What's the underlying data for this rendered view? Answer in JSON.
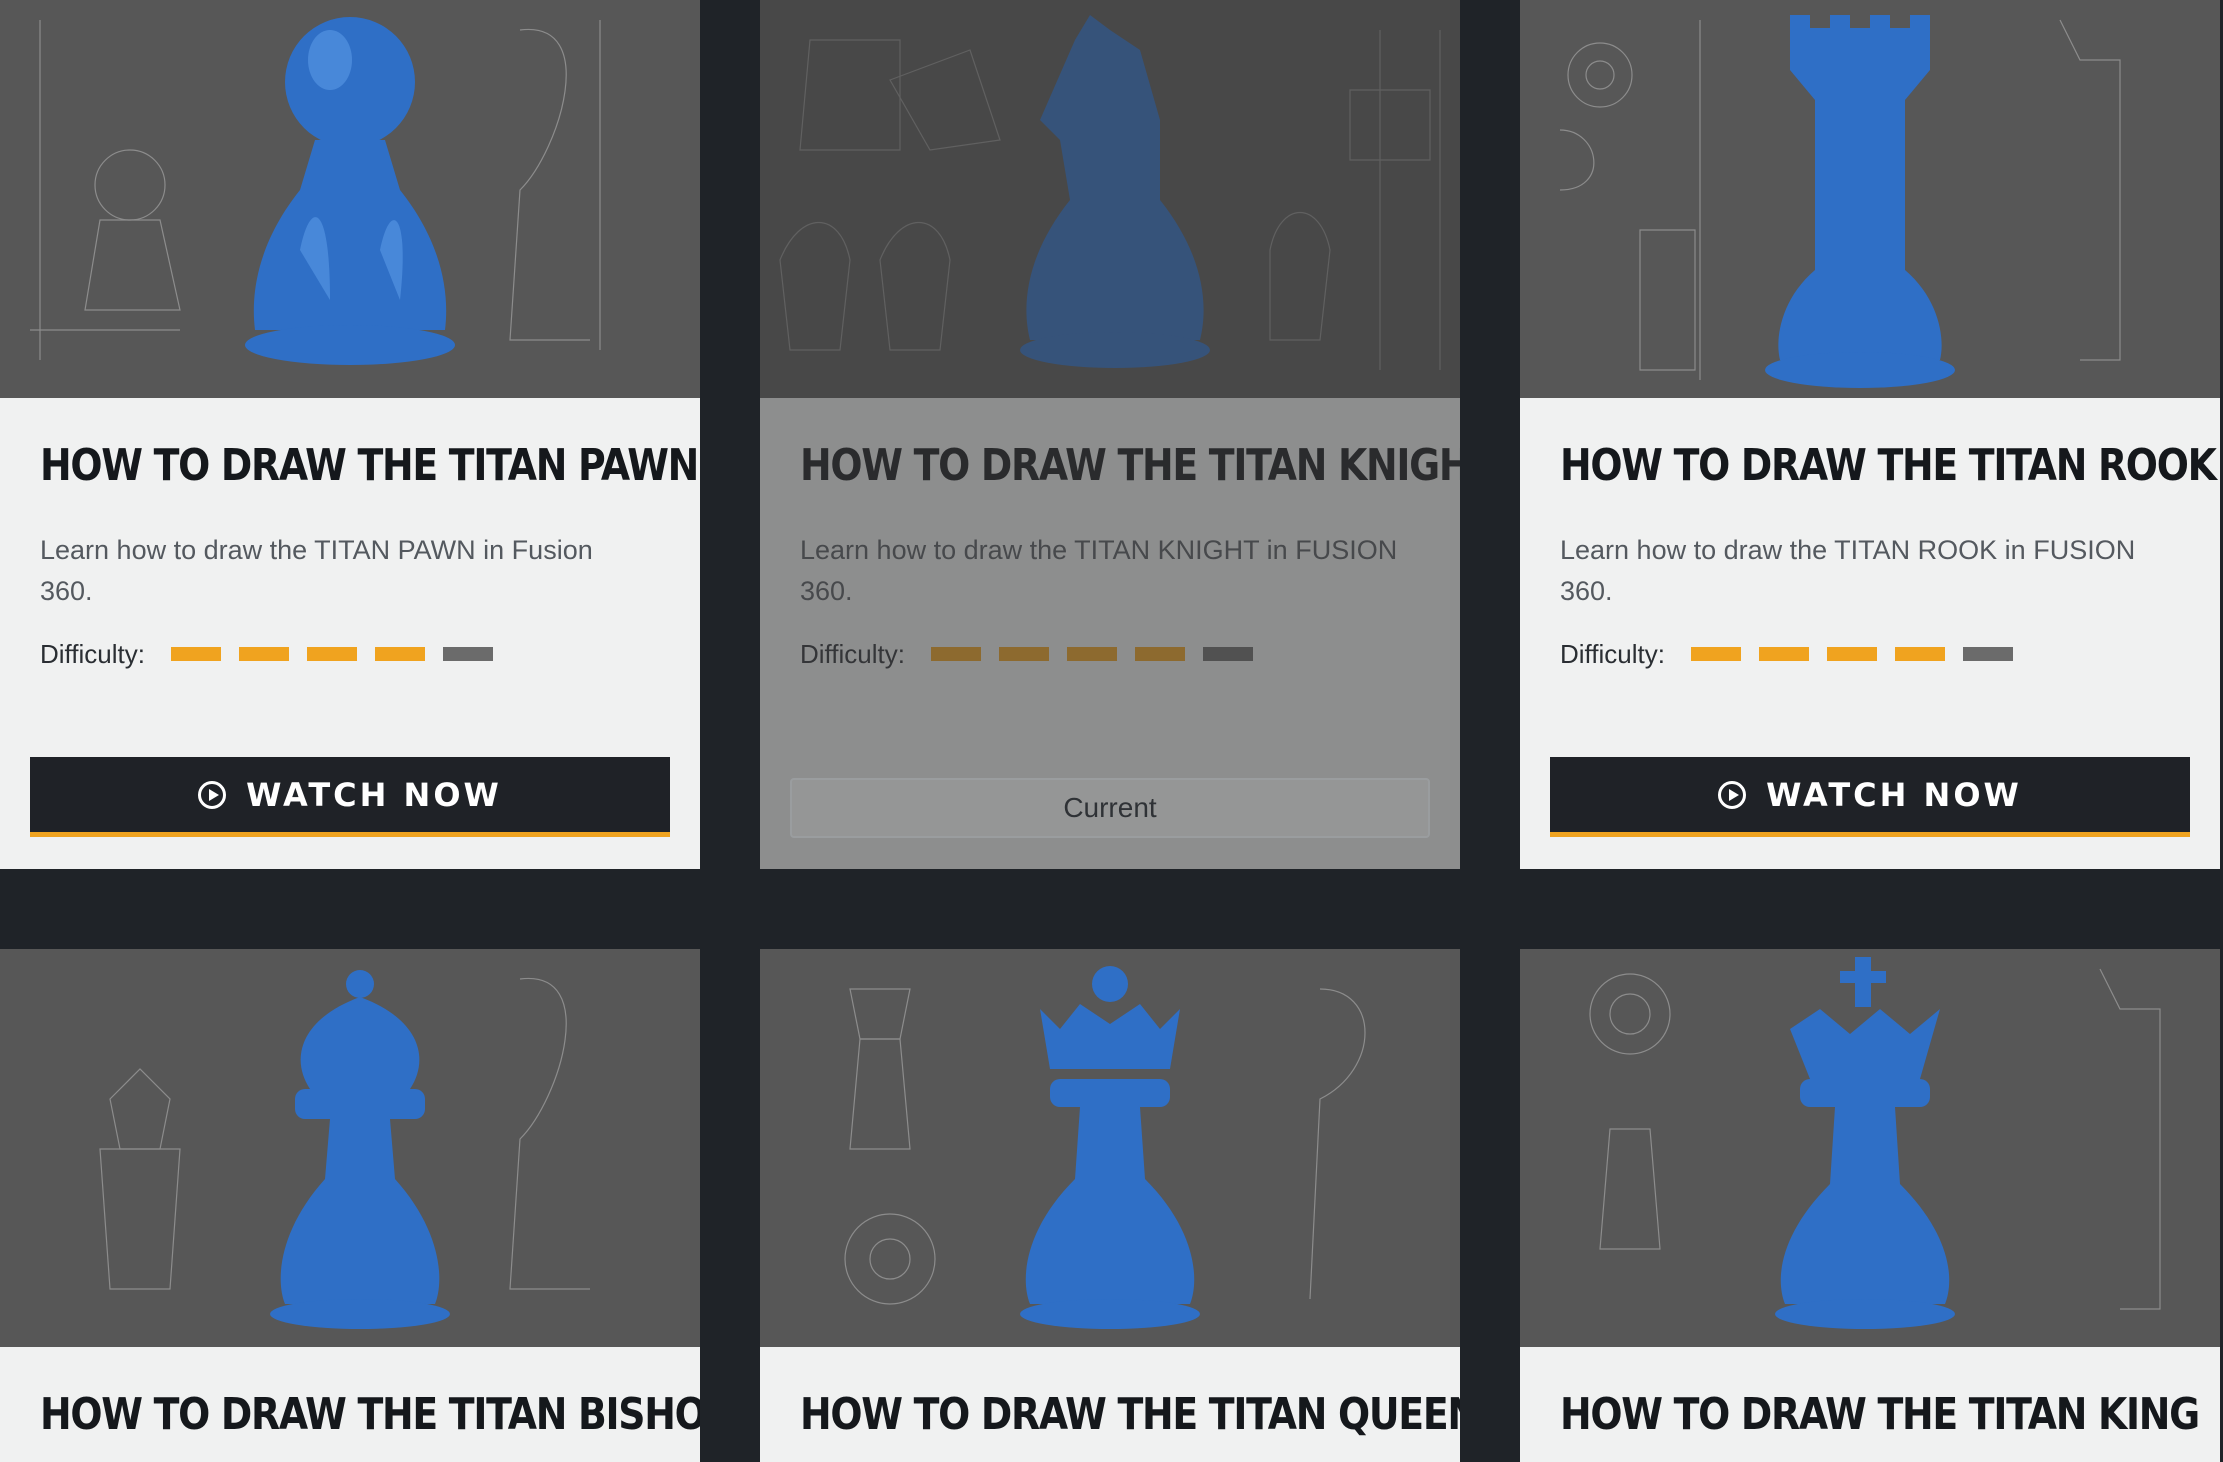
{
  "cards": [
    {
      "title": "HOW TO DRAW THE TITAN PAWN",
      "description": "Learn how to draw the TITAN PAWN in Fusion 360.",
      "difficulty_label": "Difficulty:",
      "difficulty": 4,
      "difficulty_max": 5,
      "action": "WATCH NOW",
      "image": "titan-pawn-blueprint-render"
    },
    {
      "title": "HOW TO DRAW THE TITAN KNIGHT",
      "description": "Learn how to draw the TITAN KNIGHT in FUSION 360.",
      "difficulty_label": "Difficulty:",
      "difficulty": 4,
      "difficulty_max": 5,
      "action": "Current",
      "image": "titan-knight-blueprint-render"
    },
    {
      "title": "HOW TO DRAW THE TITAN ROOK",
      "description": "Learn how to draw the TITAN ROOK in FUSION 360.",
      "difficulty_label": "Difficulty:",
      "difficulty": 4,
      "difficulty_max": 5,
      "action": "WATCH NOW",
      "image": "titan-rook-blueprint-render"
    },
    {
      "title": "HOW TO DRAW THE TITAN BISHOP",
      "image": "titan-bishop-blueprint-render"
    },
    {
      "title": "HOW TO DRAW THE TITAN QUEEN",
      "image": "titan-queen-blueprint-render"
    },
    {
      "title": "HOW TO DRAW THE TITAN KING",
      "image": "titan-king-blueprint-render"
    }
  ],
  "colors": {
    "accent": "#f0a31f",
    "page_bg": "#1f2328",
    "card_bg": "#f0f1f1",
    "thumb_bg": "#575757",
    "piece": "#2f6fc6",
    "button_bg": "#1f2227"
  },
  "icons": {
    "play": "play-circle-icon"
  }
}
